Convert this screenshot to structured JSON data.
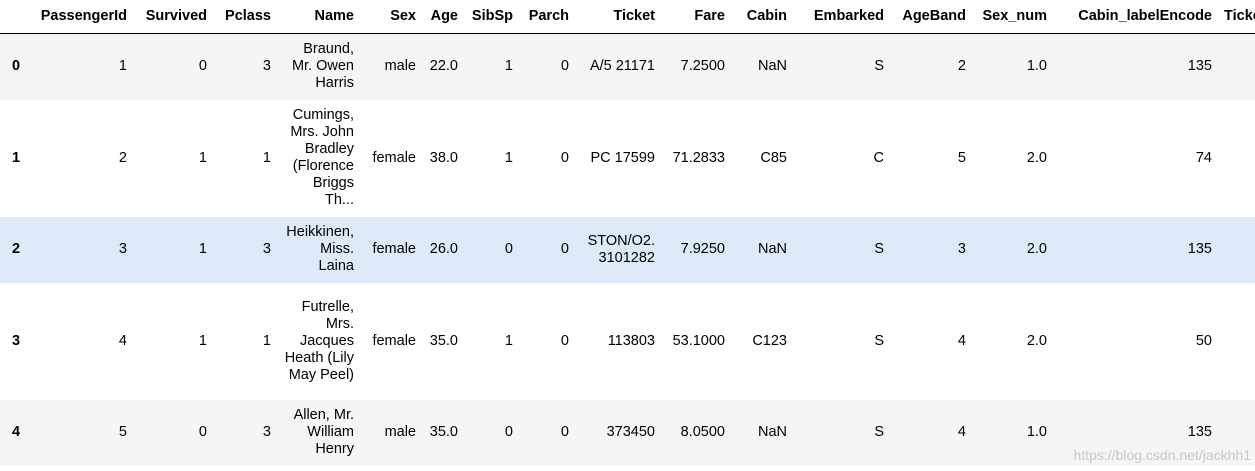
{
  "table": {
    "columns": [
      "",
      "PassengerId",
      "Survived",
      "Pclass",
      "Name",
      "Sex",
      "Age",
      "SibSp",
      "Parch",
      "Ticket",
      "Fare",
      "Cabin",
      "Embarked",
      "AgeBand",
      "Sex_num",
      "Cabin_labelEncode",
      "Ticket_"
    ],
    "rows": [
      [
        "0",
        "1",
        "0",
        "3",
        "Braund, Mr. Owen Harris",
        "male",
        "22.0",
        "1",
        "0",
        "A/5 21171",
        "7.2500",
        "NaN",
        "S",
        "2",
        "1.0",
        "135",
        ""
      ],
      [
        "1",
        "2",
        "1",
        "1",
        "Cumings, Mrs. John Bradley (Florence Briggs Th...",
        "female",
        "38.0",
        "1",
        "0",
        "PC 17599",
        "71.2833",
        "C85",
        "C",
        "5",
        "2.0",
        "74",
        ""
      ],
      [
        "2",
        "3",
        "1",
        "3",
        "Heikkinen, Miss. Laina",
        "female",
        "26.0",
        "0",
        "0",
        "STON/O2. 3101282",
        "7.9250",
        "NaN",
        "S",
        "3",
        "2.0",
        "135",
        ""
      ],
      [
        "3",
        "4",
        "1",
        "1",
        "Futrelle, Mrs. Jacques Heath (Lily May Peel)",
        "female",
        "35.0",
        "1",
        "0",
        "113803",
        "53.1000",
        "C123",
        "S",
        "4",
        "2.0",
        "50",
        ""
      ],
      [
        "4",
        "5",
        "0",
        "3",
        "Allen, Mr. William Henry",
        "male",
        "35.0",
        "0",
        "0",
        "373450",
        "8.0500",
        "NaN",
        "S",
        "4",
        "1.0",
        "135",
        ""
      ]
    ]
  },
  "watermark": "https://blog.csdn.net/jackhh1"
}
